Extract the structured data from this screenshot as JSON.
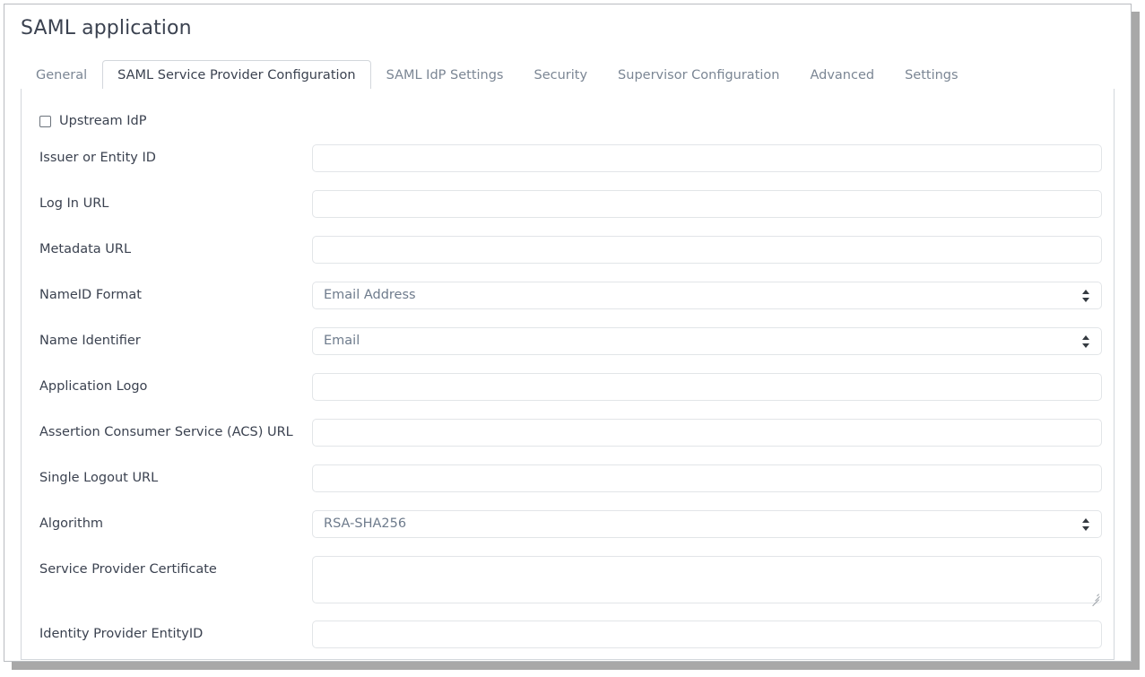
{
  "window": {
    "title": "SAML application"
  },
  "tabs": [
    {
      "label": "General",
      "active": false
    },
    {
      "label": "SAML Service Provider Configuration",
      "active": true
    },
    {
      "label": "SAML IdP Settings",
      "active": false
    },
    {
      "label": "Security",
      "active": false
    },
    {
      "label": "Supervisor Configuration",
      "active": false
    },
    {
      "label": "Advanced",
      "active": false
    },
    {
      "label": "Settings",
      "active": false
    }
  ],
  "form": {
    "upstream_idp": {
      "label": "Upstream IdP",
      "checked": false
    },
    "fields": [
      {
        "label": "Issuer or Entity ID",
        "type": "text",
        "value": "",
        "placeholder": ""
      },
      {
        "label": "Log In URL",
        "type": "text",
        "value": "",
        "placeholder": ""
      },
      {
        "label": "Metadata URL",
        "type": "text",
        "value": "",
        "placeholder": ""
      },
      {
        "label": "NameID Format",
        "type": "select",
        "value": "Email Address"
      },
      {
        "label": "Name Identifier",
        "type": "select",
        "value": "Email"
      },
      {
        "label": "Application Logo",
        "type": "text",
        "value": "",
        "placeholder": ""
      },
      {
        "label": "Assertion Consumer Service (ACS) URL",
        "type": "text",
        "value": "",
        "placeholder": ""
      },
      {
        "label": "Single Logout URL",
        "type": "text",
        "value": "",
        "placeholder": ""
      },
      {
        "label": "Algorithm",
        "type": "select",
        "value": "RSA-SHA256"
      },
      {
        "label": "Service Provider Certificate",
        "type": "textarea",
        "value": "",
        "placeholder": ""
      },
      {
        "label": "Identity Provider EntityID",
        "type": "text",
        "value": "",
        "placeholder": ""
      }
    ]
  },
  "colors": {
    "text": "#3b4250",
    "muted": "#7b8694",
    "border": "#d3d7dc",
    "control_border": "#e2e5e8",
    "control_text": "#6e7b8c",
    "shadow": "#a8a8a8"
  }
}
